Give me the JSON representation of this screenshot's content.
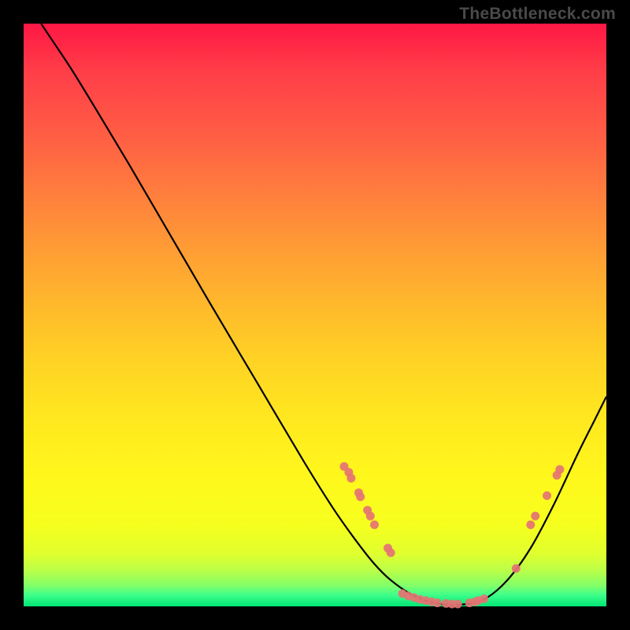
{
  "watermark": "TheBottleneck.com",
  "chart_data": {
    "type": "line",
    "title": "",
    "xlabel": "",
    "ylabel": "",
    "xlim": [
      0,
      100
    ],
    "ylim": [
      0,
      100
    ],
    "grid": false,
    "legend": false,
    "description": "Bottleneck curve over a red-to-green vertical gradient background. Curve value represents bottleneck percentage (high=red top, low=green bottom). Pink dots mark sampled data points along the curve.",
    "curve": [
      {
        "x": 3.0,
        "y": 100.0
      },
      {
        "x": 5.0,
        "y": 97.0
      },
      {
        "x": 8.0,
        "y": 92.5
      },
      {
        "x": 12.0,
        "y": 86.0
      },
      {
        "x": 18.0,
        "y": 76.0
      },
      {
        "x": 25.0,
        "y": 64.0
      },
      {
        "x": 32.0,
        "y": 52.0
      },
      {
        "x": 40.0,
        "y": 38.5
      },
      {
        "x": 48.0,
        "y": 25.0
      },
      {
        "x": 53.0,
        "y": 17.0
      },
      {
        "x": 56.5,
        "y": 12.0
      },
      {
        "x": 60.0,
        "y": 7.5
      },
      {
        "x": 63.0,
        "y": 4.5
      },
      {
        "x": 67.0,
        "y": 1.8
      },
      {
        "x": 71.0,
        "y": 0.5
      },
      {
        "x": 75.0,
        "y": 0.3
      },
      {
        "x": 79.0,
        "y": 1.2
      },
      {
        "x": 83.0,
        "y": 4.5
      },
      {
        "x": 87.0,
        "y": 10.0
      },
      {
        "x": 91.0,
        "y": 17.5
      },
      {
        "x": 95.0,
        "y": 26.0
      },
      {
        "x": 98.0,
        "y": 32.0
      },
      {
        "x": 100.0,
        "y": 36.0
      }
    ],
    "points": [
      {
        "x": 55.0,
        "y": 24.0
      },
      {
        "x": 55.8,
        "y": 23.0
      },
      {
        "x": 56.2,
        "y": 22.0
      },
      {
        "x": 57.5,
        "y": 19.5
      },
      {
        "x": 57.8,
        "y": 18.8
      },
      {
        "x": 59.0,
        "y": 16.5
      },
      {
        "x": 59.5,
        "y": 15.5
      },
      {
        "x": 60.2,
        "y": 14.0
      },
      {
        "x": 62.5,
        "y": 10.0
      },
      {
        "x": 63.0,
        "y": 9.2
      },
      {
        "x": 65.0,
        "y": 2.2
      },
      {
        "x": 66.0,
        "y": 1.8
      },
      {
        "x": 67.0,
        "y": 1.5
      },
      {
        "x": 68.0,
        "y": 1.2
      },
      {
        "x": 69.0,
        "y": 1.0
      },
      {
        "x": 70.0,
        "y": 0.8
      },
      {
        "x": 71.0,
        "y": 0.6
      },
      {
        "x": 72.5,
        "y": 0.5
      },
      {
        "x": 73.5,
        "y": 0.4
      },
      {
        "x": 74.5,
        "y": 0.4
      },
      {
        "x": 76.5,
        "y": 0.6
      },
      {
        "x": 77.5,
        "y": 0.8
      },
      {
        "x": 78.0,
        "y": 1.0
      },
      {
        "x": 79.0,
        "y": 1.3
      },
      {
        "x": 84.5,
        "y": 6.5
      },
      {
        "x": 87.0,
        "y": 14.0
      },
      {
        "x": 87.8,
        "y": 15.5
      },
      {
        "x": 89.8,
        "y": 19.0
      },
      {
        "x": 91.5,
        "y": 22.5
      },
      {
        "x": 92.0,
        "y": 23.5
      }
    ],
    "colors": {
      "curve": "#000000",
      "points": "#e57373"
    }
  }
}
